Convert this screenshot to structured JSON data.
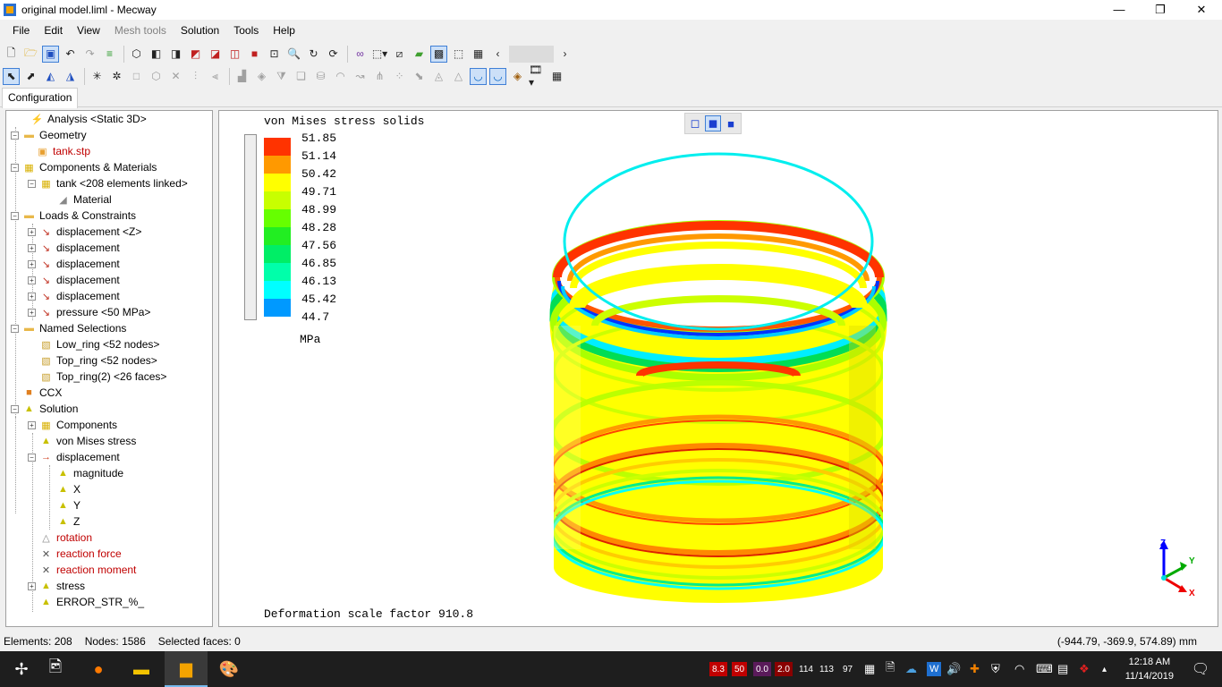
{
  "window": {
    "title": "original model.liml - Mecway",
    "minimize": "—",
    "restore": "❐",
    "close": "✕"
  },
  "menu": [
    "File",
    "Edit",
    "View",
    "Mesh tools",
    "Solution",
    "Tools",
    "Help"
  ],
  "tab": "Configuration",
  "tree": [
    {
      "label": "Analysis <Static 3D>",
      "icon": "⚡",
      "color": "#c9a000"
    },
    {
      "label": "Geometry",
      "icon": "▬",
      "color": "#e8b84a"
    },
    {
      "label": "tank.stp",
      "icon": "▣",
      "color": "#e8a030",
      "red": true
    },
    {
      "label": "Components & Materials",
      "icon": "▦",
      "color": "#d8b000"
    },
    {
      "label": "tank <208 elements linked>",
      "icon": "▦",
      "color": "#d8b000"
    },
    {
      "label": "Material",
      "icon": "◢",
      "color": "#888888"
    },
    {
      "label": "Loads & Constraints",
      "icon": "▬",
      "color": "#e8b84a"
    },
    {
      "label": "displacement <Z>",
      "icon": "↘",
      "color": "#c03020"
    },
    {
      "label": "displacement",
      "icon": "↘",
      "color": "#c03020"
    },
    {
      "label": "displacement",
      "icon": "↘",
      "color": "#c03020"
    },
    {
      "label": "displacement",
      "icon": "↘",
      "color": "#c03020"
    },
    {
      "label": "displacement",
      "icon": "↘",
      "color": "#c03020"
    },
    {
      "label": "pressure <50 MPa>",
      "icon": "↘",
      "color": "#c03020"
    },
    {
      "label": "Named Selections",
      "icon": "▬",
      "color": "#e8b84a"
    },
    {
      "label": "Low_ring <52 nodes>",
      "icon": "▧",
      "color": "#c8a030"
    },
    {
      "label": "Top_ring <52 nodes>",
      "icon": "▧",
      "color": "#c8a030"
    },
    {
      "label": "Top_ring(2) <26 faces>",
      "icon": "▧",
      "color": "#c8a030"
    },
    {
      "label": "CCX",
      "icon": "■",
      "color": "#e08020"
    },
    {
      "label": "Solution",
      "icon": "▲",
      "color": "#c8c000"
    },
    {
      "label": "Components",
      "icon": "▦",
      "color": "#d8b000"
    },
    {
      "label": "von Mises stress",
      "icon": "▲",
      "color": "#c8c000"
    },
    {
      "label": "displacement",
      "icon": "→",
      "color": "#d04020"
    },
    {
      "label": "magnitude",
      "icon": "▲",
      "color": "#c8c000"
    },
    {
      "label": "X",
      "icon": "▲",
      "color": "#c8c000"
    },
    {
      "label": "Y",
      "icon": "▲",
      "color": "#c8c000"
    },
    {
      "label": "Z",
      "icon": "▲",
      "color": "#c8c000"
    },
    {
      "label": "rotation",
      "icon": "△",
      "color": "#888888",
      "red": true
    },
    {
      "label": "reaction force",
      "icon": "✕",
      "color": "#555555",
      "red": true
    },
    {
      "label": "reaction moment",
      "icon": "✕",
      "color": "#555555",
      "red": true
    },
    {
      "label": "stress",
      "icon": "▲",
      "color": "#c8c000"
    },
    {
      "label": "ERROR_STR_%_",
      "icon": "▲",
      "color": "#c8c000"
    }
  ],
  "viewport": {
    "title": "von Mises stress solids",
    "footer": "Deformation scale factor 910.8",
    "legend": {
      "unit": "MPa",
      "labels": [
        "51.85",
        "51.14",
        "50.42",
        "49.71",
        "48.99",
        "48.28",
        "47.56",
        "46.85",
        "46.13",
        "45.42",
        "44.7"
      ],
      "colors": [
        "#ff3300",
        "#ff9900",
        "#ffff00",
        "#c8ff00",
        "#66ff00",
        "#22ee22",
        "#00ee66",
        "#00ffaa",
        "#00ffff",
        "#0099ff",
        "#0033ff"
      ]
    },
    "axes": {
      "x": "X",
      "y": "Y",
      "z": "Z"
    }
  },
  "status": {
    "elements": "Elements: 208",
    "nodes": "Nodes: 1586",
    "faces": "Selected faces: 0",
    "coords": "(-944.79, -369.9, 574.89) mm"
  },
  "tray": {
    "gpu1": "8.3",
    "gpu2": "50",
    "gpu3": "0.0",
    "gpu4": "2.0",
    "n1": "114",
    "n2": "113",
    "n3": "97",
    "time": "12:18 AM",
    "date": "11/14/2019"
  }
}
